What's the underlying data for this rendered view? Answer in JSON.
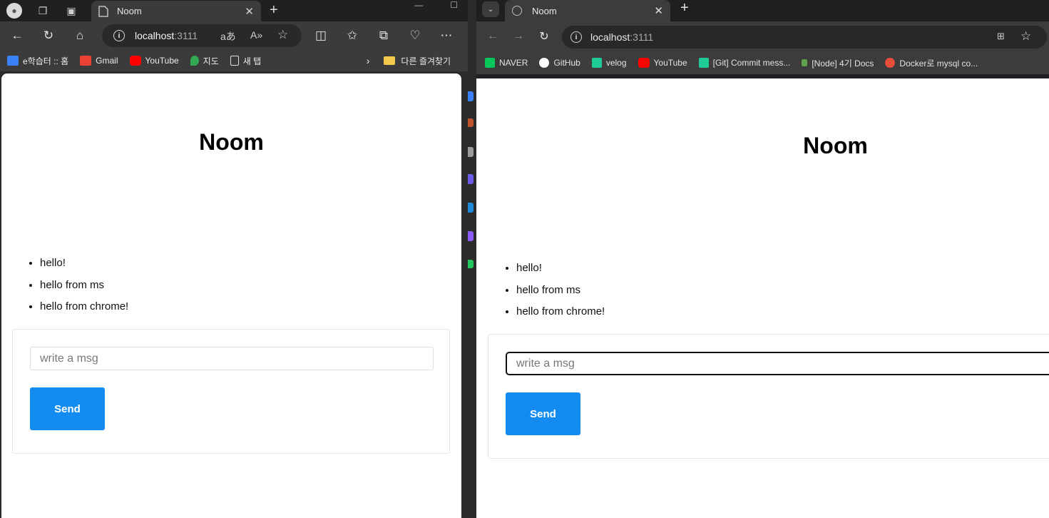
{
  "edge": {
    "tab": {
      "title": "Noom",
      "close": "✕"
    },
    "new_tab": "+",
    "url": {
      "host": "localhost",
      "port": ":3111"
    },
    "bookmarks": [
      {
        "label": "e학습터 :: 홈",
        "icon": "globe-icon",
        "color": "#3b82f6"
      },
      {
        "label": "Gmail",
        "icon": "gmail-icon",
        "color": "#ea4335"
      },
      {
        "label": "YouTube",
        "icon": "youtube-icon",
        "color": "#ff0000"
      },
      {
        "label": "지도",
        "icon": "map-pin-icon",
        "color": "#34a853"
      },
      {
        "label": "새 탭",
        "icon": "page-icon",
        "color": "#dddddd"
      }
    ],
    "other_favorites": "다른 즐겨찾기"
  },
  "chrome": {
    "tab": {
      "title": "Noom",
      "close": "✕"
    },
    "new_tab": "+",
    "url": {
      "host": "localhost",
      "port": ":3111"
    },
    "bookmarks": [
      {
        "label": "NAVER",
        "icon": "naver-icon",
        "color": "#03c75a"
      },
      {
        "label": "GitHub",
        "icon": "github-icon",
        "color": "#ffffff"
      },
      {
        "label": "velog",
        "icon": "velog-icon",
        "color": "#20c997"
      },
      {
        "label": "YouTube",
        "icon": "youtube-icon",
        "color": "#ff0000"
      },
      {
        "label": "[Git] Commit mess...",
        "icon": "velog-icon",
        "color": "#20c997"
      },
      {
        "label": "[Node] 4기 Docs",
        "icon": "node-icon",
        "color": "#5fa04e"
      },
      {
        "label": "Docker로 mysql co...",
        "icon": "docker-icon",
        "color": "#e74c3c"
      }
    ]
  },
  "page": {
    "title": "Noom",
    "messages": [
      "hello!",
      "hello from ms",
      "hello from chrome!"
    ],
    "input_placeholder": "write a msg",
    "send_label": "Send",
    "accent": "#148bf0"
  }
}
